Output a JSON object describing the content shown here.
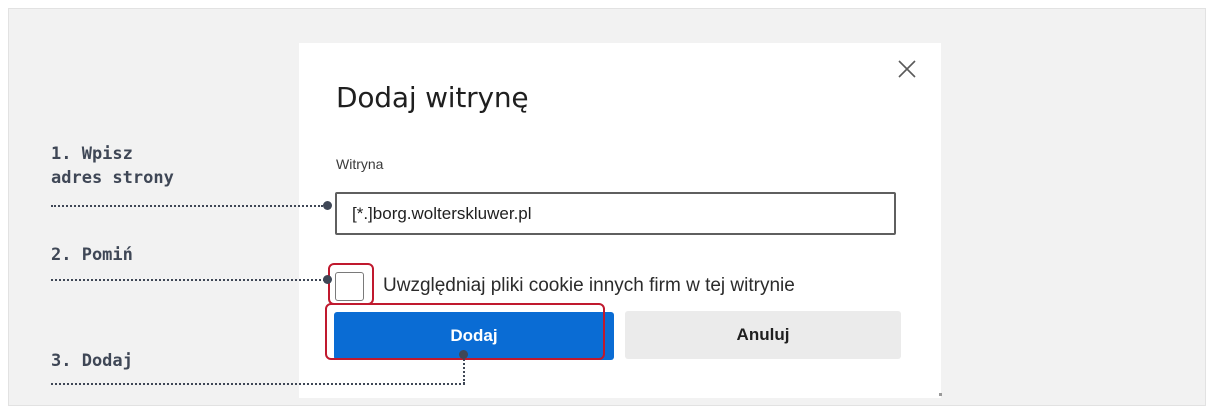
{
  "dialog": {
    "title": "Dodaj witrynę",
    "field_label": "Witryna",
    "url_value": "[*.]borg.wolterskluwer.pl",
    "checkbox_label": "Uwzględniaj pliki cookie innych firm w tej witrynie",
    "checkbox_checked": false,
    "add_button": "Dodaj",
    "cancel_button": "Anuluj",
    "close_icon": "close-icon"
  },
  "callouts": {
    "step1_line1": "1. Wpisz",
    "step1_line2": "adres strony",
    "step2": "2. Pomiń",
    "step3": "3. Dodaj"
  },
  "colors": {
    "primary": "#0a6cd4",
    "highlight": "#c0192e",
    "callout_text": "#3f4756",
    "background": "#f2f2f2"
  }
}
